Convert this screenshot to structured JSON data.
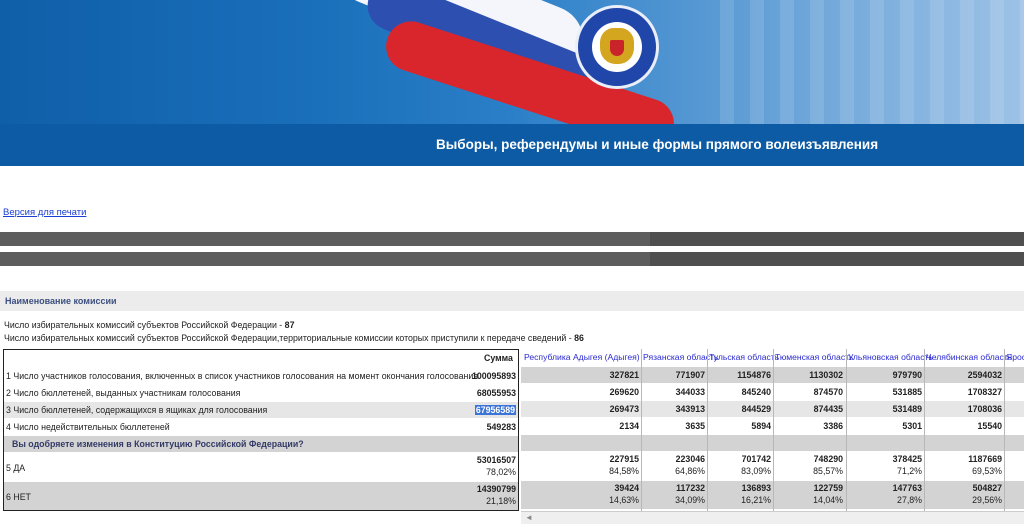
{
  "header": {
    "title": "Выборы, референдумы и иные формы прямого волеизъявления"
  },
  "print_link": "Версия для печати",
  "commission_label": "Наименование комиссии",
  "counts": {
    "line1_text": "Число избирательных комиссий субъектов Российской Федерации - ",
    "line1_value": "87",
    "line2_text": "Число избирательных комиссий субъектов Российской Федерации,территориальные комиссии которых приступили к передаче сведений - ",
    "line2_value": "86"
  },
  "table": {
    "sum_header": "Сумма",
    "rows": [
      {
        "label": "1 Число участников голосования, включенных в список участников голосования на момент окончания голосования",
        "sum": "100095893"
      },
      {
        "label": "2 Число бюллетеней, выданных участникам голосования",
        "sum": "68055953"
      },
      {
        "label": "3 Число бюллетеней, содержащихся в ящиках для голосования",
        "sum": "67956589"
      },
      {
        "label": "4 Число недействительных бюллетеней",
        "sum": "549283"
      }
    ],
    "question": "Вы одобряете изменения в Конституцию Российской Федерации?",
    "yes": {
      "label": "5 ДА",
      "sum": "53016507",
      "pct": "78,02%"
    },
    "no": {
      "label": "6 НЕТ",
      "sum": "14390799",
      "pct": "21,18%"
    }
  },
  "regions": [
    {
      "name": "Республика Адыгея (Адыгея)",
      "v1": "327821",
      "v2": "269620",
      "v3": "269473",
      "v4": "2134",
      "yes": "227915",
      "yes_pct": "84,58%",
      "no": "39424",
      "no_pct": "14,63%"
    },
    {
      "name": "Рязанская область",
      "v1": "771907",
      "v2": "344033",
      "v3": "343913",
      "v4": "3635",
      "yes": "223046",
      "yes_pct": "64,86%",
      "no": "117232",
      "no_pct": "34,09%"
    },
    {
      "name": "Тульская область",
      "v1": "1154876",
      "v2": "845240",
      "v3": "844529",
      "v4": "5894",
      "yes": "701742",
      "yes_pct": "83,09%",
      "no": "136893",
      "no_pct": "16,21%"
    },
    {
      "name": "Тюменская область",
      "v1": "1130302",
      "v2": "874570",
      "v3": "874435",
      "v4": "3386",
      "yes": "748290",
      "yes_pct": "85,57%",
      "no": "122759",
      "no_pct": "14,04%"
    },
    {
      "name": "Ульяновская область",
      "v1": "979790",
      "v2": "531885",
      "v3": "531489",
      "v4": "5301",
      "yes": "378425",
      "yes_pct": "71,2%",
      "no": "147763",
      "no_pct": "27,8%"
    },
    {
      "name": "Челябинская область",
      "v1": "2594032",
      "v2": "1708327",
      "v3": "1708036",
      "v4": "15540",
      "yes": "1187669",
      "yes_pct": "69,53%",
      "no": "504827",
      "no_pct": "29,56%"
    },
    {
      "name": "Яросл"
    }
  ],
  "scroll": {
    "arrow": "◄"
  }
}
